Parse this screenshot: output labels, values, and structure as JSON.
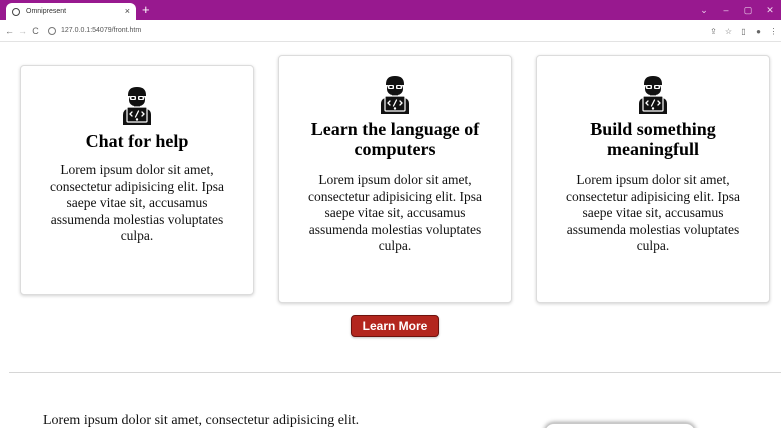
{
  "browser": {
    "tab_title": "Omnipresent",
    "tab_close": "×",
    "new_tab": "+",
    "url": "127.0.0.1:54079/front.htm",
    "back": "←",
    "forward": "→",
    "reload": "C",
    "share": "⇪",
    "star": "☆",
    "split": "▯",
    "profile": "●",
    "menu": "⋮",
    "minimize": "–",
    "maximize": "▢",
    "close": "✕",
    "chevron": "⌄",
    "tabbar_color": "#98198f"
  },
  "cards": [
    {
      "icon": "developer-icon",
      "title": "Chat for help",
      "text": "Lorem ipsum dolor sit amet, consectetur adipisicing elit. Ipsa saepe vitae sit, accusamus assumenda molestias voluptates culpa."
    },
    {
      "icon": "developer-icon",
      "title": "Learn the language of computers",
      "text": "Lorem ipsum dolor sit amet, consectetur adipisicing elit. Ipsa saepe vitae sit, accusamus assumenda molestias voluptates culpa."
    },
    {
      "icon": "developer-icon",
      "title": "Build something meaningfull",
      "text": "Lorem ipsum dolor sit amet, consectetur adipisicing elit. Ipsa saepe vitae sit, accusamus assumenda molestias voluptates culpa."
    }
  ],
  "learn_more": {
    "label": "Learn More",
    "color": "#b3261e"
  },
  "bottom": {
    "text": "Lorem ipsum dolor sit amet, consectetur adipisicing elit."
  }
}
